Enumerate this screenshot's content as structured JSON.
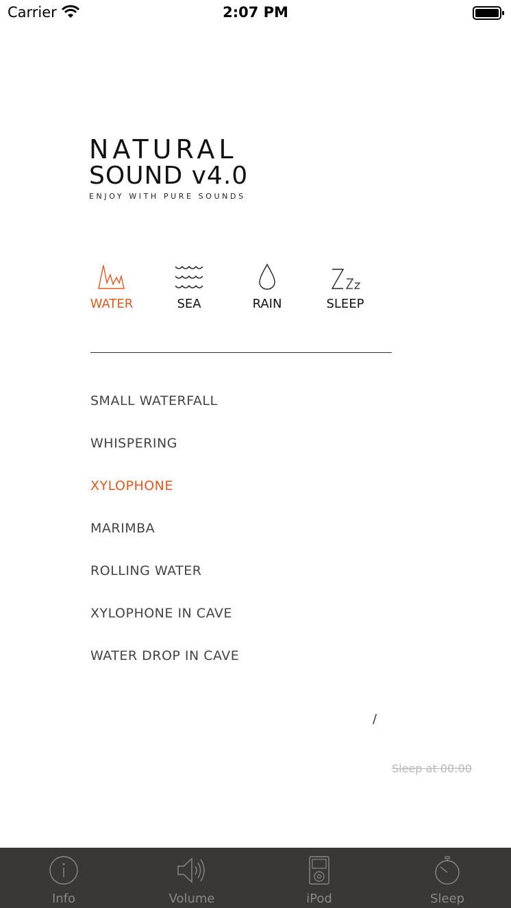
{
  "status_bar": {
    "carrier": "Carrier",
    "time": "2:07 PM"
  },
  "logo": {
    "line1": "NATURAL",
    "line2": "SOUND v4.0",
    "tagline": "ENJOY WITH PURE SOUNDS"
  },
  "categories": [
    {
      "label": "WATER",
      "icon": "water-wave-icon",
      "active": true
    },
    {
      "label": "SEA",
      "icon": "sea-waves-icon",
      "active": false
    },
    {
      "label": "RAIN",
      "icon": "raindrop-icon",
      "active": false
    },
    {
      "label": "SLEEP",
      "icon": "zzz-icon",
      "active": false
    }
  ],
  "tracks": [
    {
      "label": "SMALL WATERFALL",
      "active": false
    },
    {
      "label": "WHISPERING",
      "active": false
    },
    {
      "label": "XYLOPHONE",
      "active": true
    },
    {
      "label": "MARIMBA",
      "active": false
    },
    {
      "label": "ROLLING WATER",
      "active": false
    },
    {
      "label": "XYLOPHONE IN CAVE",
      "active": false
    },
    {
      "label": "WATER DROP IN CAVE",
      "active": false
    }
  ],
  "playback": {
    "separator": "/"
  },
  "sleep_timer": {
    "text": "Sleep at 00:00"
  },
  "tab_bar": [
    {
      "label": "Info",
      "icon": "info-icon"
    },
    {
      "label": "Volume",
      "icon": "speaker-icon"
    },
    {
      "label": "iPod",
      "icon": "ipod-icon"
    },
    {
      "label": "Sleep",
      "icon": "stopwatch-icon"
    }
  ],
  "colors": {
    "accent": "#e2581f",
    "tab_bar_bg": "#3a3836",
    "tab_inactive": "#8a8886"
  }
}
